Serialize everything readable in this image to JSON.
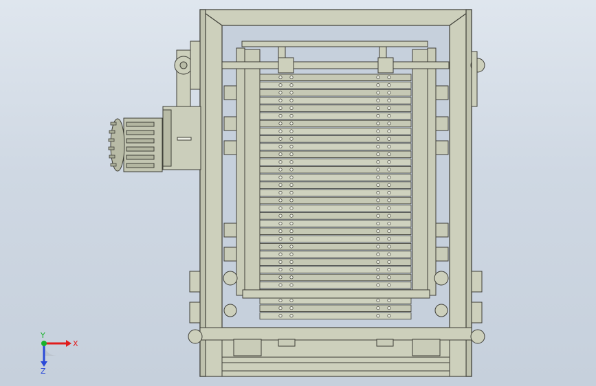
{
  "viewport": {
    "background_top": "#dfe6ee",
    "background_bottom": "#c6d0dc",
    "model_fill": "#c9ccb8",
    "model_stroke": "#3d3d36",
    "model_shade": "#a9ad98"
  },
  "triad": {
    "x_label": "X",
    "y_label": "Y",
    "z_label": "Z",
    "x_color": "#e11c1c",
    "y_color": "#19b22c",
    "z_color": "#2a49d8"
  }
}
